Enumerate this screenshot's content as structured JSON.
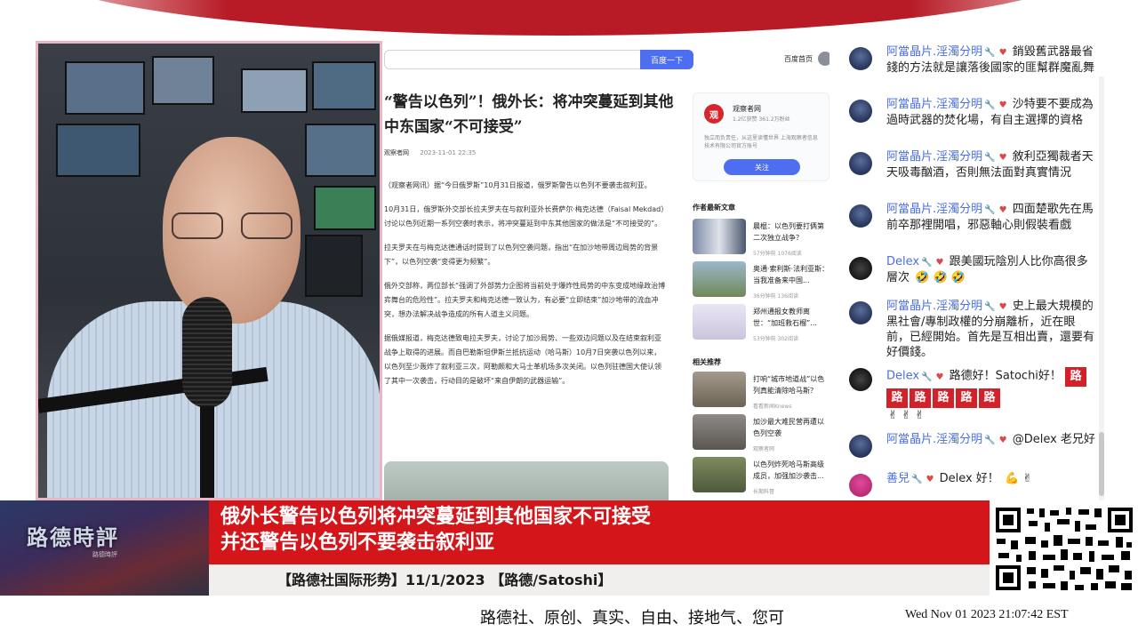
{
  "browser": {
    "search_button": "百度一下",
    "home_link": "百度首页",
    "article": {
      "title": "“警告以色列”！俄外长：将冲突蔓延到其他中东国家“不可接受”",
      "source": "观察者网",
      "datetime": "2023-11-01 22:35",
      "paragraphs": [
        "（观察者网讯）据“今日俄罗斯”10月31日报道，俄罗斯警告以色列不要袭击叙利亚。",
        "10月31日，俄罗斯外交部长拉夫罗夫在与叙利亚外长费萨尔·梅克达德（Faisal Mekdad）讨论以色列近期一系列空袭时表示，将冲突蔓延到中东其他国家的做法是“不可接受的”。",
        "拉夫罗夫在与梅克达德通话时提到了以色列空袭问题，指出“在加沙地带周边局势的背景下”，以色列空袭“变得更为频繁”。",
        "俄外交部称，两位部长“强调了外部势力企图将当前处于爆炸性局势的中东变成地缘政治博弈舞台的危险性”。拉夫罗夫和梅克达德一致认为，有必要“立即结束”加沙地带的流血冲突，想办法解决战争造成的所有人道主义问题。",
        "据俄媒报道，梅克达德致电拉夫罗夫，讨论了加沙局势、一些双边问题以及在结束叙利亚战争上取得的进展。而自巴勒斯坦伊斯兰抵抗运动（哈马斯）10月7日突袭以色列以来，以色列至少轰炸了叙利亚三次，阿勒颇和大马士革机场多次关闭。以色列驻德国大使认领了其中一次袭击，行动目的是破坏“来自伊朗的武器运输”。"
      ]
    },
    "sidebar": {
      "account_logo": "观",
      "account_name": "观察者网",
      "account_fans": "1.2亿获赞 361.2万粉丝",
      "account_desc": "独立而负责任，从这里读懂世界 上海观察者信息技术有限公司官方账号",
      "follow_button": "关注",
      "latest_heading": "作者最新文章",
      "latest": [
        {
          "title": "晨棍：以色列要打俩第二次独立战争？",
          "meta": "57分钟前  1076阅读"
        },
        {
          "title": "奥通·索利斯·法利亚斯：当我准备来中国...",
          "meta": "36分钟前  136阅读"
        },
        {
          "title": "郑州通报女教师离世：“加班救石榴”...",
          "meta": "53分钟前  302阅读"
        }
      ],
      "related_heading": "相关推荐",
      "related": [
        {
          "title": "打响“城市地道战”以色列真能清除哈马斯？",
          "meta": "看看新闻Knews"
        },
        {
          "title": "加沙最大难民营再遭以色列空袭",
          "meta": "观察者网"
        },
        {
          "title": "以色列炸死哈马斯高级成员，加强加沙袭击...",
          "meta": "长期料督"
        }
      ]
    }
  },
  "chat": {
    "messages": [
      {
        "user": "阿當晶片.淫濁分明",
        "avatar": "avatar-blue",
        "text": "銷毀舊武器最省錢的方法就是讓落後國家的匪幫群魔亂舞"
      },
      {
        "user": "阿當晶片.淫濁分明",
        "avatar": "avatar-blue",
        "text": "沙特要不要成為過時武器的焚化場，有自主選擇的資格"
      },
      {
        "user": "阿當晶片.淫濁分明",
        "avatar": "avatar-blue",
        "text": "敘利亞獨裁者天天吸毒酗酒，否則無法面對真實情況"
      },
      {
        "user": "阿當晶片.淫濁分明",
        "avatar": "avatar-blue",
        "text": "四面楚歌先在馬前卒那裡開唱，邪惡軸心則假裝看戲"
      },
      {
        "user": "Delex",
        "avatar": "avatar-dark",
        "text": "跟美國玩陰別人比你高很多層次",
        "emoji": "🤣 🤣 🤣"
      },
      {
        "user": "阿當晶片.淫濁分明",
        "avatar": "avatar-blue",
        "text": "史上最大規模的黑社會/專制政權的分崩離析，近在眼前，已經開始。首先是互相出賣，還要有好價錢。"
      },
      {
        "user": "Delex",
        "avatar": "avatar-dark",
        "text": "路德好！Satochi好！",
        "badges": [
          "路",
          "路",
          "路",
          "路",
          "路",
          "路"
        ],
        "emoji": "✌ ✌ ✌"
      },
      {
        "user": "阿當晶片.淫濁分明",
        "avatar": "avatar-blue",
        "text": "@Delex 老兄好"
      },
      {
        "user": "善兒",
        "avatar": "avatar-pink",
        "text": "Delex 好！",
        "emoji": "💪 ✌"
      }
    ]
  },
  "lower_third": {
    "logo_title": "路德時評",
    "logo_sub": "路德時評",
    "headline": "俄外长警告以色列将冲突蔓延到其他国家不可接受\n并还警告以色列不要袭击叙利亚",
    "subline": "【路德社国际形势】11/1/2023 【路德/Satoshi】"
  },
  "footer": {
    "slogan": "路德社、原创、真实、自由、接地气、您可",
    "clock": "Wed Nov 01 2023 21:07:42 EST"
  },
  "colors": {
    "banner_red": "#d4161b",
    "chat_username": "#4a6fe0",
    "search_button": "#4e6ef2"
  }
}
